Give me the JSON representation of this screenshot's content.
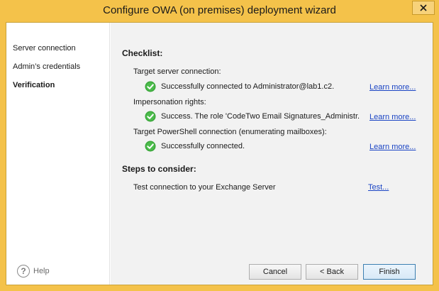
{
  "window": {
    "title": "Configure OWA (on premises) deployment wizard",
    "accent_color": "#f4c24a"
  },
  "sidebar": {
    "items": [
      {
        "label": "Server connection",
        "active": false
      },
      {
        "label": "Admin’s credentials",
        "active": false
      },
      {
        "label": "Verification",
        "active": true
      }
    ],
    "help_label": "Help",
    "help_icon": "question-circle-icon"
  },
  "checklist": {
    "title": "Checklist:",
    "items": [
      {
        "label": "Target server connection:",
        "status_icon": "green-check-icon",
        "status": "Successfully connected to Administrator@lab1.c2.",
        "link": "Learn more..."
      },
      {
        "label": "Impersonation rights:",
        "status_icon": "green-check-icon",
        "status": "Success. The role 'CodeTwo Email Signatures_Administr...",
        "link": "Learn more..."
      },
      {
        "label": "Target PowerShell connection (enumerating mailboxes):",
        "status_icon": "green-check-icon",
        "status": "Successfully connected.",
        "link": "Learn more..."
      }
    ]
  },
  "steps": {
    "title": "Steps to consider:",
    "items": [
      {
        "label": "Test connection to your Exchange Server",
        "link": "Test..."
      }
    ]
  },
  "buttons": {
    "cancel": "Cancel",
    "back": "< Back",
    "finish": "Finish"
  }
}
